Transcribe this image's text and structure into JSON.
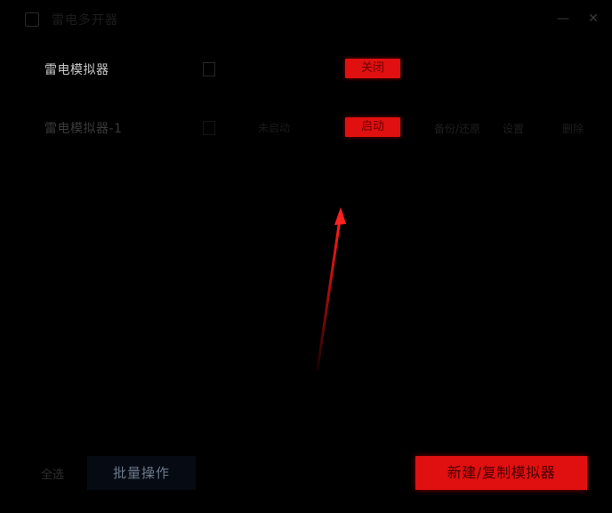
{
  "window": {
    "title": "雷电多开器",
    "minimize_label": "—",
    "close_label": "✕"
  },
  "rows": [
    {
      "name": "雷电模拟器",
      "info": "",
      "action_label": "关闭",
      "extras": [
        "",
        "",
        ""
      ]
    },
    {
      "name": "雷电模拟器-1",
      "info": "未启动",
      "action_label": "启动",
      "extras": [
        "备份/还原",
        "设置",
        "删除"
      ]
    }
  ],
  "footer": {
    "select_all_label": "全选",
    "batch_label": "批量操作",
    "new_label": "新建/复制模拟器"
  },
  "colors": {
    "accent": "#e01010",
    "background": "#000000",
    "batch_bg": "#060a12"
  }
}
